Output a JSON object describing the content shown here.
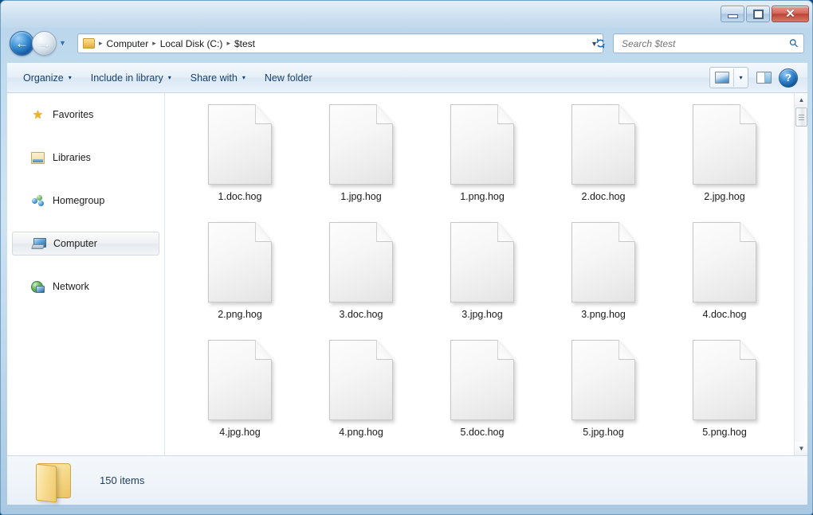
{
  "window": {
    "controls": {
      "minimize_label": "—",
      "maximize_label": "□",
      "close_label": "✕"
    }
  },
  "addressbar": {
    "back_arrow": "←",
    "forward_arrow": "→",
    "history_caret": "▼",
    "breadcrumbs": [
      "Computer",
      "Local Disk (C:)",
      "$test"
    ],
    "separator": "▸",
    "dropdown_caret": "▼",
    "refresh_label": "↻"
  },
  "search": {
    "placeholder": "Search $test",
    "value": "",
    "icon": "search-icon"
  },
  "toolbar": {
    "items": [
      {
        "label": "Organize",
        "has_caret": true
      },
      {
        "label": "Include in library",
        "has_caret": true
      },
      {
        "label": "Share with",
        "has_caret": true
      },
      {
        "label": "New folder",
        "has_caret": false
      }
    ],
    "caret_glyph": "▾",
    "view_button_icon": "view-change-icon",
    "view_caret": "▾",
    "preview_pane_icon": "preview-pane-icon",
    "help_label": "?"
  },
  "sidebar": {
    "items": [
      {
        "label": "Favorites",
        "icon": "star-icon",
        "selected": false
      },
      {
        "label": "Libraries",
        "icon": "library-icon",
        "selected": false
      },
      {
        "label": "Homegroup",
        "icon": "homegroup-icon",
        "selected": false
      },
      {
        "label": "Computer",
        "icon": "computer-icon",
        "selected": true
      },
      {
        "label": "Network",
        "icon": "network-icon",
        "selected": false
      }
    ]
  },
  "content": {
    "files": [
      {
        "name": "1.doc.hog"
      },
      {
        "name": "1.jpg.hog"
      },
      {
        "name": "1.png.hog"
      },
      {
        "name": "2.doc.hog"
      },
      {
        "name": "2.jpg.hog"
      },
      {
        "name": "2.png.hog"
      },
      {
        "name": "3.doc.hog"
      },
      {
        "name": "3.jpg.hog"
      },
      {
        "name": "3.png.hog"
      },
      {
        "name": "4.doc.hog"
      },
      {
        "name": "4.jpg.hog"
      },
      {
        "name": "4.png.hog"
      },
      {
        "name": "5.doc.hog"
      },
      {
        "name": "5.jpg.hog"
      },
      {
        "name": "5.png.hog"
      }
    ]
  },
  "scrollbar": {
    "up_arrow": "▲",
    "down_arrow": "▼"
  },
  "statusbar": {
    "item_count_text": "150 items",
    "folder_icon": "folder-icon"
  },
  "colors": {
    "frame": "#c3dcef",
    "accent_blue": "#1c5fa8",
    "close_red": "#bc4433",
    "text_dark": "#1a1a1a",
    "toolbar_text": "#16406d"
  }
}
